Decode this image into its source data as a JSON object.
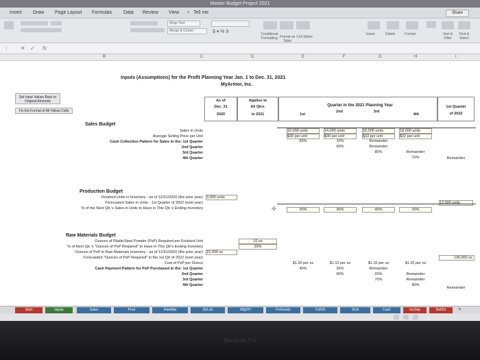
{
  "window": {
    "title": "Master Budget Project 2021"
  },
  "menu": {
    "items": [
      "Insert",
      "Draw",
      "Page Layout",
      "Formulas",
      "Data",
      "Review",
      "View"
    ],
    "tell_me": "Tell me",
    "share": "Share"
  },
  "ribbon": {
    "wrap_text": "Wrap Text",
    "merge_center": "Merge & Center",
    "number_format": "$ ▾ % 9",
    "conditional_formatting": "Conditional Formatting",
    "format_as_table": "Format as Table",
    "cell_styles": "Cell Styles",
    "insert": "Insert",
    "delete": "Delete",
    "format": "Format",
    "sort_filter": "Sort & Filter",
    "find_select": "Find & Select"
  },
  "formula_bar": {
    "fx": "fx"
  },
  "columns": [
    "B",
    "C",
    "D",
    "E",
    "F",
    "G",
    "H",
    "I"
  ],
  "sheet": {
    "title_line1": "Inputs (Assumptions) for the Profit Planning Year Jan. 1 to Dec. 31, 2021",
    "title_line2": "MyArmor, Inc.",
    "reset_button": "Set Input Values Back to Original Amounts",
    "fix_format_button": "Fix the Format of All Yellow Cells",
    "hdr_asof": [
      "As of",
      "Dec. 31",
      "2020"
    ],
    "hdr_applies": [
      "Applies to",
      "All Qtrs.",
      "in 2021"
    ],
    "hdr_quarter": "Quarter in the 2021 Planning Year",
    "hdr_q": [
      "1st",
      "2nd",
      "3rd",
      "4th"
    ],
    "hdr_q1_2022": [
      "1st Quarter",
      "of 2022"
    ],
    "sales": {
      "title": "Sales Budget",
      "labels": [
        "Sales in Units",
        "Average Selling Price per Unit",
        "Cash Collection Pattern for Sales in the: 1st Quarter",
        "2nd Quarter",
        "3rd Quarter",
        "4th Quarter"
      ],
      "units": [
        "10,000 units",
        "14,000 units",
        "16,000 units",
        "18,000 units"
      ],
      "price": [
        "$30 per unit",
        "$30 per unit",
        "$32 per unit",
        "$32 per unit"
      ],
      "collect_1st": [
        "60%",
        "10%",
        "Remainder"
      ],
      "collect_2nd": [
        "60%",
        "Remainder"
      ],
      "collect_3rd": [
        "80%",
        "Remainder",
        "Remainder"
      ],
      "collect_4th": [
        "70%"
      ]
    },
    "production": {
      "title": "Production Budget",
      "labels": [
        "Finished Units in Inventory - as of 12/31/2020 (the prior year)",
        "Forecasted Sales in Units - 1st Quarter of 2022 (next year)",
        "% of the Next Qtr.'s Sales in Units to Have in This Qtr.'s Ending Inventory"
      ],
      "inventory": "3,000 units",
      "next_year_sales": "12,000 units",
      "pct": [
        "20%",
        "30%",
        "40%",
        "20%"
      ]
    },
    "materials": {
      "title": "Raw Materials Budget",
      "labels": [
        "Ounces of PlasticSteel Powder (PsP) Required per Finished Unit",
        "% of Next Qtr.'s \"Ounces of PsP Required\" to Have in This Qtr's Ending Inventory",
        "Ounces of PsP in Raw Materials Inventory - as of 12/31/2020 (the prior year)",
        "Forecasted \"Ounces of PsP Required\" in the 1st Qtr of 2022 (next year)",
        "Cost of PsP per Ounce",
        "Cash Payment Pattern for PsP Purchased in the: 1st Quarter",
        "2nd Quarter",
        "3rd Quarter",
        "4th Quarter"
      ],
      "oz_per_unit": "10 oz",
      "inv_pct": "20%",
      "inventory": "15,000 oz",
      "next_year_oz": "130,000 oz",
      "cost": [
        "$1.20 per oz",
        "$1.10 per oz",
        "$1.10 per oz",
        "$1.20 per oz"
      ],
      "pay_1st": [
        "40%",
        "30%",
        "Remainder"
      ],
      "pay_2nd": [
        "60%",
        "20%",
        "Remainder"
      ],
      "pay_3rd": [
        "70%",
        "Remainder"
      ],
      "pay_4th": [
        "80%",
        "Remainder"
      ]
    }
  },
  "tabs": [
    "Start",
    "Inputs",
    "Sales",
    "Prod",
    "RawMat",
    "DirLab",
    "MfgOH",
    "FinGoods",
    "CofGS",
    "SGA",
    "Cash",
    "IncStat",
    "BalSht"
  ],
  "bezel_label": "MacBook Pro"
}
